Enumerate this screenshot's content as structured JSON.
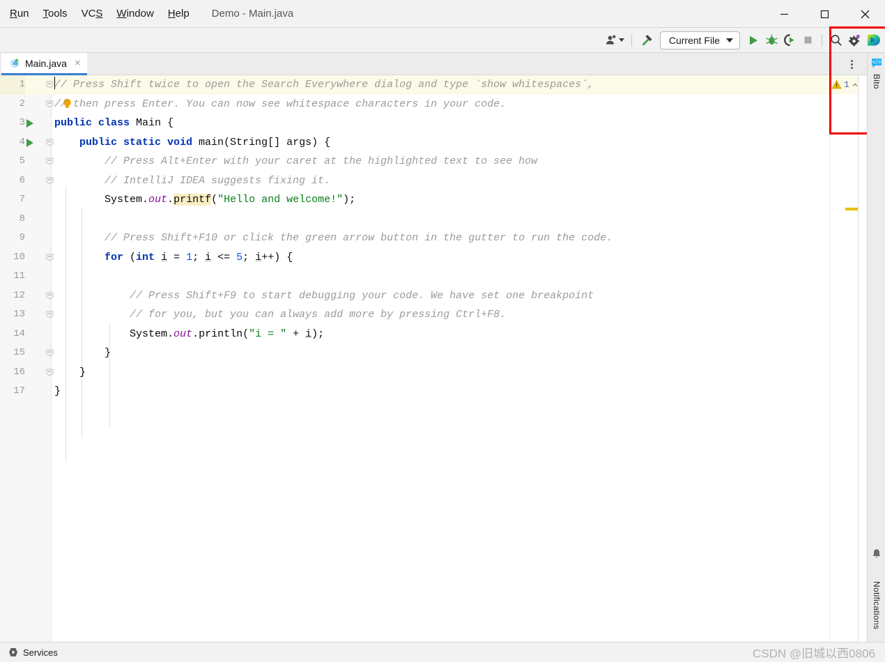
{
  "window": {
    "title": "Demo - Main.java",
    "menu": [
      {
        "label": "Run",
        "mnemonic": "R"
      },
      {
        "label": "Tools",
        "mnemonic": "T"
      },
      {
        "label": "VCS",
        "mnemonic": "S"
      },
      {
        "label": "Window",
        "mnemonic": "W"
      },
      {
        "label": "Help",
        "mnemonic": "H"
      }
    ],
    "controls": [
      {
        "name": "minimize-button",
        "glyph": "minimize"
      },
      {
        "name": "maximize-button",
        "glyph": "maximize"
      },
      {
        "name": "close-button",
        "glyph": "close"
      }
    ]
  },
  "toolbar": {
    "account_icon": "user-account-icon",
    "build_icon": "hammer-build-icon",
    "run_config": "Current File",
    "run_icon": "run-play-icon",
    "debug_icon": "debug-bug-icon",
    "run_coverage_icon": "run-with-coverage-icon",
    "stop_icon": "stop-square-icon",
    "search_icon": "search-icon",
    "settings_icon": "gear-settings-icon",
    "bito_icon": "bito-logo-icon"
  },
  "tabs": {
    "items": [
      {
        "label": "Main.java",
        "icon": "java-class-icon",
        "close": "×",
        "active": true
      }
    ],
    "kebab": "more-options-icon"
  },
  "editor": {
    "inspection": {
      "warning_icon": "warning-triangle-icon",
      "warning_count": "1",
      "prev_icon": "chevron-up-icon",
      "next_icon": "chevron-down-icon"
    },
    "lines": [
      {
        "n": "1",
        "highlight": true,
        "run": false,
        "fold": "minus-top",
        "bulb": false,
        "indent": 0
      },
      {
        "n": "2",
        "highlight": false,
        "run": false,
        "fold": "minus-end",
        "bulb": true,
        "indent": 0
      },
      {
        "n": "3",
        "highlight": false,
        "run": true,
        "fold": "",
        "bulb": false,
        "indent": 0
      },
      {
        "n": "4",
        "highlight": false,
        "run": true,
        "fold": "minus-top",
        "bulb": false,
        "indent": 1
      },
      {
        "n": "5",
        "highlight": false,
        "run": false,
        "fold": "minus-top",
        "bulb": false,
        "indent": 1
      },
      {
        "n": "6",
        "highlight": false,
        "run": false,
        "fold": "minus-end",
        "bulb": false,
        "indent": 1
      },
      {
        "n": "7",
        "highlight": false,
        "run": false,
        "fold": "",
        "bulb": false,
        "indent": 1
      },
      {
        "n": "8",
        "highlight": false,
        "run": false,
        "fold": "",
        "bulb": false,
        "indent": 1
      },
      {
        "n": "9",
        "highlight": false,
        "run": false,
        "fold": "",
        "bulb": false,
        "indent": 1
      },
      {
        "n": "10",
        "highlight": false,
        "run": false,
        "fold": "minus-top",
        "bulb": false,
        "indent": 1
      },
      {
        "n": "11",
        "highlight": false,
        "run": false,
        "fold": "",
        "bulb": false,
        "indent": 2
      },
      {
        "n": "12",
        "highlight": false,
        "run": false,
        "fold": "minus-top",
        "bulb": false,
        "indent": 2
      },
      {
        "n": "13",
        "highlight": false,
        "run": false,
        "fold": "minus-end",
        "bulb": false,
        "indent": 2
      },
      {
        "n": "14",
        "highlight": false,
        "run": false,
        "fold": "",
        "bulb": false,
        "indent": 2
      },
      {
        "n": "15",
        "highlight": false,
        "run": false,
        "fold": "minus-end",
        "bulb": false,
        "indent": 1
      },
      {
        "n": "16",
        "highlight": false,
        "run": false,
        "fold": "minus-end",
        "bulb": false,
        "indent": 0
      },
      {
        "n": "17",
        "highlight": false,
        "run": false,
        "fold": "",
        "bulb": false,
        "indent": 0
      }
    ],
    "code": [
      "// Press Shift twice to open the Search Everywhere dialog and type `show whitespaces`,",
      "// then press Enter. You can now see whitespace characters in your code.",
      "public class Main {",
      "    public static void main(String[] args) {",
      "        // Press Alt+Enter with your caret at the highlighted text to see how",
      "        // IntelliJ IDEA suggests fixing it.",
      "        System.out.printf(\"Hello and welcome!\");",
      "",
      "        // Press Shift+F10 or click the green arrow button in the gutter to run the code.",
      "        for (int i = 1; i <= 5; i++) {",
      "",
      "            // Press Shift+F9 to start debugging your code. We have set one breakpoint",
      "            // for you, but you can always add more by pressing Ctrl+F8.",
      "            System.out.println(\"i = \" + i);",
      "        }",
      "    }",
      "}"
    ]
  },
  "right_strip": {
    "bito_icon": "bito-chat-icon",
    "bito_label": "Bito",
    "notifications_icon": "bell-notifications-icon",
    "notifications_label": "Notifications"
  },
  "statusbar": {
    "services_icon": "services-play-icon",
    "services_label": "Services",
    "watermark": "CSDN @旧城以西0806"
  },
  "colors": {
    "accent": "#3a7cd0",
    "run_green": "#3c9e47",
    "warning_yellow": "#e8c000",
    "annotation_red": "#ee0000",
    "keyword_blue": "#0033b3",
    "string_green": "#067d17",
    "comment_gray": "#9b9b9b",
    "field_purple": "#871094",
    "number_blue": "#1750eb",
    "highlight_bg": "#f7eec2"
  }
}
